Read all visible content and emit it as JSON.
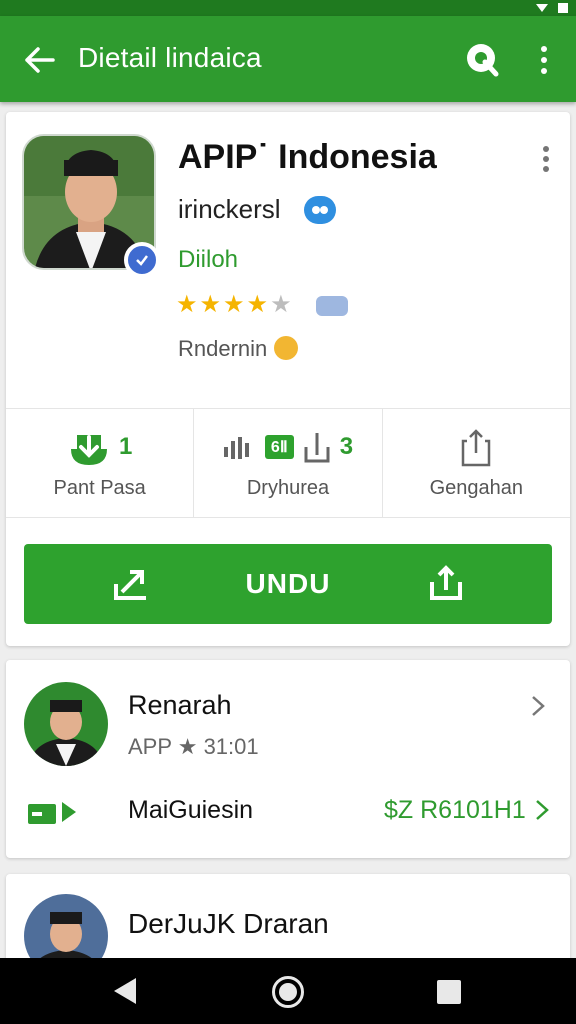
{
  "app_bar": {
    "title": "Dietail lindaica"
  },
  "app": {
    "name": "APIP˙ Indonesia",
    "developer": "irinckersl",
    "category": "Diiloh",
    "rating_stars": 4,
    "content_rating": "Rndernin"
  },
  "stats": [
    {
      "value": "1",
      "label": "Pant Pasa",
      "icon": "download-icon"
    },
    {
      "value": "3",
      "label": "Dryhurea",
      "icon": "signal-icon"
    },
    {
      "value": "",
      "label": "Gengahan",
      "icon": "share-icon"
    }
  ],
  "stat_badge": "6Ⅱ",
  "install_button": {
    "label": "UNDU"
  },
  "review_card": {
    "name": "Renarah",
    "meta": "APP ★ 31:01",
    "payment_label": "MaiGuiesin",
    "price": "$Z R6101H1"
  },
  "review_card_2": {
    "name": "DerJuJK Draran"
  },
  "colors": {
    "primary": "#2f9b2f",
    "status_bar": "#1f7a1f",
    "star": "#f5b400",
    "badge_blue": "#2f8fe0"
  }
}
